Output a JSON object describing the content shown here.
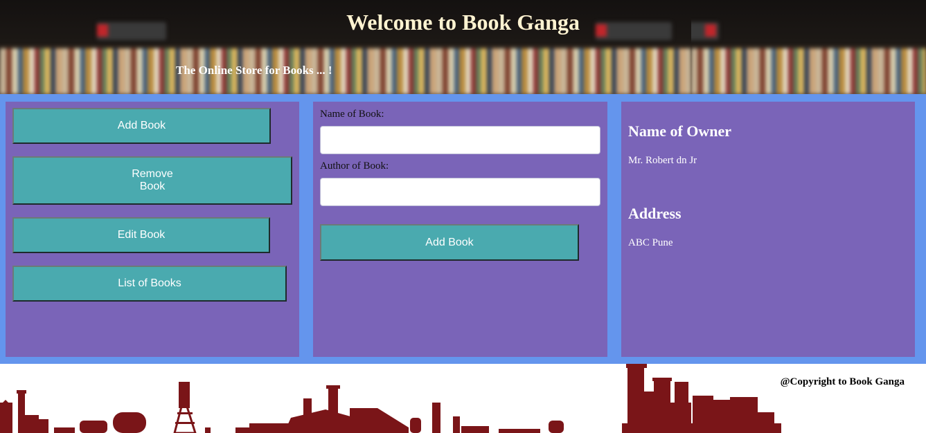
{
  "header": {
    "title": "Welcome to Book Ganga",
    "subtitle": "The Online Store for Books ... !"
  },
  "menu": {
    "add_book": "Add Book",
    "remove_book_line1": "Remove",
    "remove_book_line2": "Book",
    "edit_book": "Edit Book",
    "list_books": "List of Books"
  },
  "form": {
    "name_label": "Name of Book:",
    "name_value": "",
    "author_label": "Author of Book:",
    "author_value": "",
    "submit_label": "Add Book"
  },
  "owner": {
    "name_heading": "Name of Owner",
    "name_value": "Mr. Robert dn Jr",
    "address_heading": "Address",
    "address_value": "ABC Pune"
  },
  "footer": {
    "copyright": "@Copyright to Book Ganga"
  },
  "colors": {
    "main_background": "#6495ed",
    "panel": "#7a64b8",
    "button": "#4aaaaf",
    "title_text": "#fff3d1",
    "skyline": "#7a1518"
  },
  "icons": [
    "bookshelf-banner-image",
    "industrial-skyline-image"
  ]
}
